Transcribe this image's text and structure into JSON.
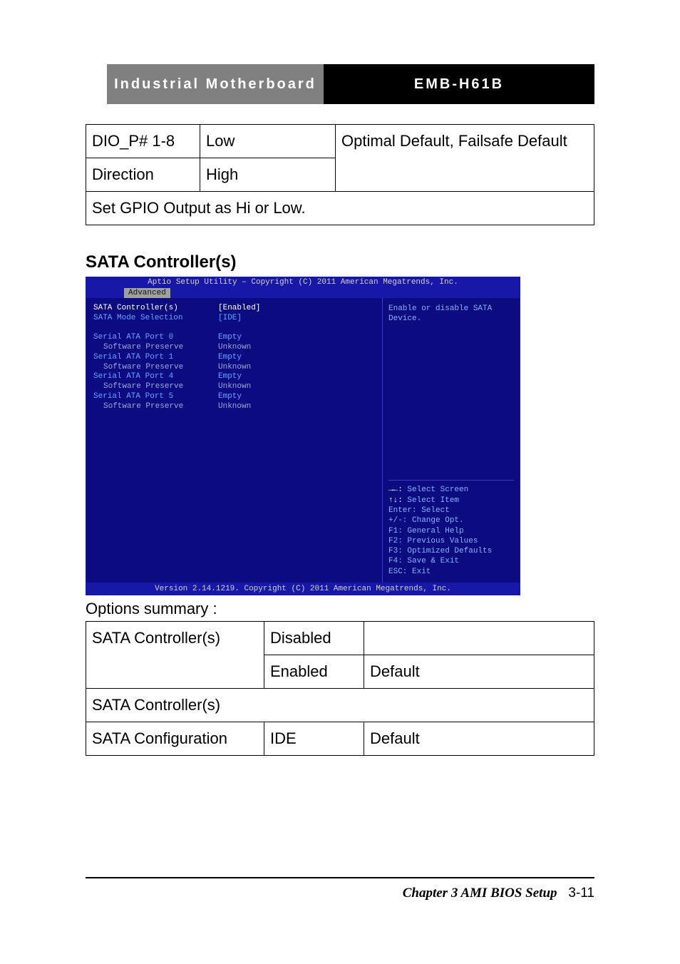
{
  "header": {
    "left": "Industrial Motherboard",
    "right": "EMB-H61B"
  },
  "table1": {
    "r1c1": "DIO_P# 1-8",
    "r1c2": "Low",
    "r2c1": "Direction",
    "r2c2": "High",
    "note": "Optimal Default, Failsafe Default",
    "desc": "Set GPIO Output as Hi or Low."
  },
  "section_title": "SATA Controller(s)",
  "bios": {
    "title": "Aptio Setup Utility – Copyright (C) 2011 American Megatrends, Inc.",
    "tab": "Advanced",
    "rows": [
      {
        "label": "SATA Controller(s)",
        "value": "[Enabled]",
        "selected": true
      },
      {
        "label": "SATA Mode Selection",
        "value": "[IDE]"
      },
      {
        "spacer": true
      },
      {
        "label": "Serial ATA Port 0",
        "value": "Empty"
      },
      {
        "label": "Software Preserve",
        "value": "Unknown",
        "indent": true
      },
      {
        "label": "Serial ATA Port 1",
        "value": "Empty"
      },
      {
        "label": "Software Preserve",
        "value": "Unknown",
        "indent": true
      },
      {
        "label": "Serial ATA Port 4",
        "value": "Empty"
      },
      {
        "label": "Software Preserve",
        "value": "Unknown",
        "indent": true
      },
      {
        "label": "Serial ATA Port 5",
        "value": "Empty"
      },
      {
        "label": "Software Preserve",
        "value": "Unknown",
        "indent": true
      }
    ],
    "help": "Enable or disable SATA Device.",
    "keys": [
      "→←: Select Screen",
      "↑↓: Select Item",
      "Enter: Select",
      "+/-: Change Opt.",
      "F1: General Help",
      "F2: Previous Values",
      "F3: Optimized Defaults",
      "F4: Save & Exit",
      "ESC: Exit"
    ],
    "footer": "Version 2.14.1219. Copyright (C) 2011 American Megatrends, Inc."
  },
  "summary_label": "Options summary :",
  "table2": {
    "r1c1": "SATA Controller(s)",
    "r1c2": "Disabled",
    "r1c3": "",
    "r2c2": "Enabled",
    "r2c3": "Default",
    "desc1": "SATA Controller(s)",
    "r3c1": "SATA Configuration",
    "r3c2": "IDE",
    "r3c3": "Default"
  },
  "footer": {
    "chapter": "Chapter 3 AMI BIOS Setup",
    "page": "3-11"
  }
}
